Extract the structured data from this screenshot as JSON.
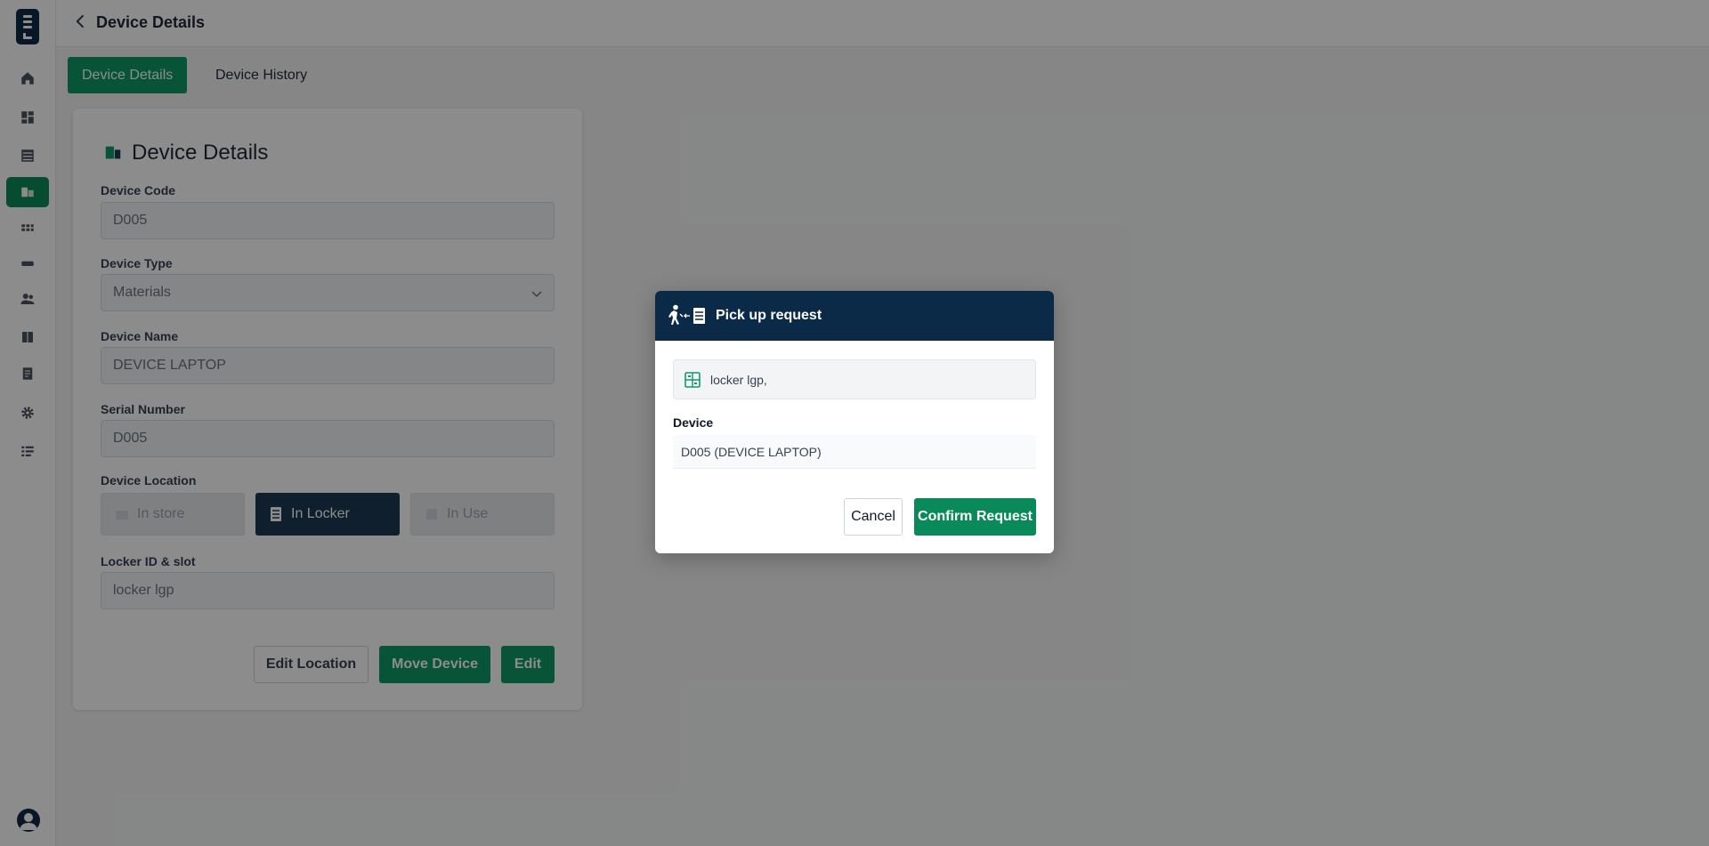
{
  "header": {
    "title": "Device Details"
  },
  "tabs": [
    {
      "label": "Device Details",
      "active": true
    },
    {
      "label": "Device History",
      "active": false
    }
  ],
  "card": {
    "title": "Device Details",
    "fields": {
      "device_code": {
        "label": "Device Code",
        "value": "D005"
      },
      "device_type": {
        "label": "Device Type",
        "value": "Materials"
      },
      "device_name": {
        "label": "Device Name",
        "value": "DEVICE LAPTOP"
      },
      "serial_number": {
        "label": "Serial Number",
        "value": "D005"
      },
      "device_location": {
        "label": "Device Location",
        "options": [
          "In store",
          "In Locker",
          "In Use"
        ],
        "selected": "In Locker"
      },
      "locker_slot": {
        "label": "Locker ID & slot",
        "value": "locker lgp"
      }
    },
    "buttons": {
      "edit_location": "Edit Location",
      "move_device": "Move Device",
      "edit": "Edit"
    }
  },
  "modal": {
    "title": "Pick up request",
    "locker": "locker lgp,",
    "device_label": "Device",
    "device_value": "D005 (DEVICE LAPTOP)",
    "cancel": "Cancel",
    "confirm": "Confirm Request"
  },
  "icons": [
    "home-icon",
    "dashboard-icon",
    "storage-icon",
    "devices-icon",
    "grid-icon",
    "card-icon",
    "users-icon",
    "locker-icon",
    "report-icon",
    "settings-icon",
    "list-icon",
    "user-avatar-icon"
  ],
  "colors": {
    "primary": "#0f9a68",
    "navy": "#0b2a47",
    "active_location": "#1e3a52"
  }
}
